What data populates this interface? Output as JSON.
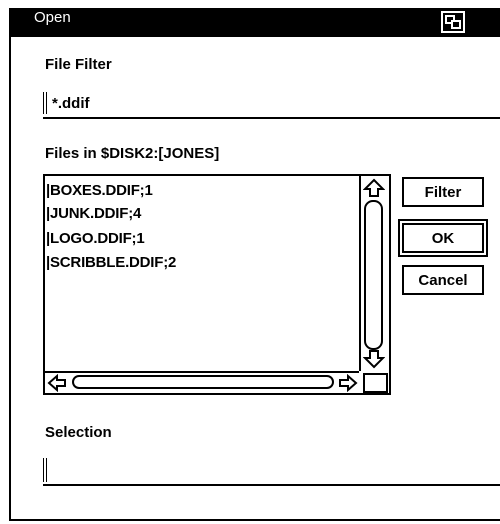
{
  "window": {
    "title": "Open",
    "menu_icon": "window-menu-icon"
  },
  "file_filter": {
    "label": "File Filter",
    "value": "*.ddif"
  },
  "files": {
    "label": "Files in $DISK2:[JONES]",
    "items": [
      "BOXES.DDIF;1",
      "JUNK.DDIF;4",
      "LOGO.DDIF;1",
      "SCRIBBLE.DDIF;2"
    ]
  },
  "buttons": {
    "filter": "Filter",
    "ok": "OK",
    "cancel": "Cancel"
  },
  "selection": {
    "label": "Selection",
    "value": ""
  },
  "icons": {
    "scroll_up": "up-arrow-icon",
    "scroll_down": "down-arrow-icon",
    "scroll_left": "left-arrow-icon",
    "scroll_right": "right-arrow-icon"
  }
}
